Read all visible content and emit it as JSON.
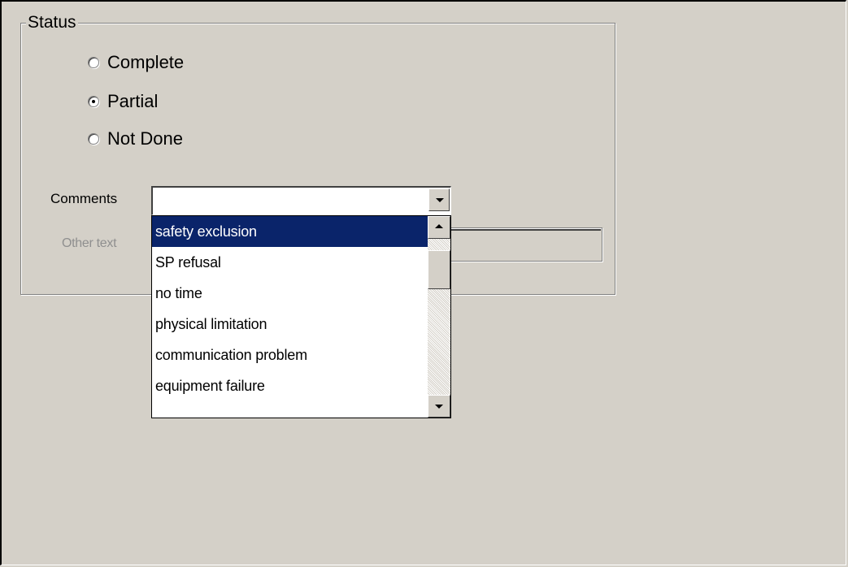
{
  "status_group": {
    "legend": "Status",
    "options": [
      {
        "label": "Complete",
        "checked": false
      },
      {
        "label": "Partial",
        "checked": true
      },
      {
        "label": "Not Done",
        "checked": false
      }
    ]
  },
  "comments": {
    "label": "Comments",
    "value": ""
  },
  "other_text": {
    "label": "Other text"
  },
  "dropdown": {
    "items": [
      "safety exclusion",
      "SP refusal",
      "no time",
      "physical limitation",
      "communication problem",
      "equipment failure"
    ],
    "highlighted": "safety exclusion"
  },
  "colors": {
    "background": "#d4d0c8",
    "highlight": "#0a246a",
    "disabled_text": "#8f8f8f"
  }
}
